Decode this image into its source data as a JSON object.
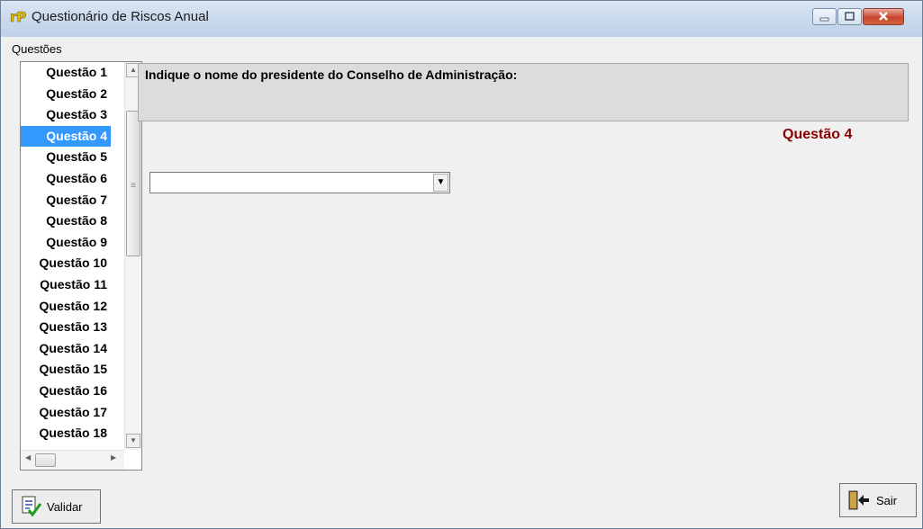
{
  "window": {
    "title": "Questionário de Riscos Anual",
    "icon": "rp-app-icon"
  },
  "sidebar": {
    "label": "Questões",
    "selected_index": 3,
    "items": [
      {
        "label": "Questão 1"
      },
      {
        "label": "Questão 2"
      },
      {
        "label": "Questão 3"
      },
      {
        "label": "Questão 4"
      },
      {
        "label": "Questão 5"
      },
      {
        "label": "Questão 6"
      },
      {
        "label": "Questão 7"
      },
      {
        "label": "Questão 8"
      },
      {
        "label": "Questão 9"
      },
      {
        "label": "Questão 10"
      },
      {
        "label": "Questão 11"
      },
      {
        "label": "Questão 12"
      },
      {
        "label": "Questão 13"
      },
      {
        "label": "Questão 14"
      },
      {
        "label": "Questão 15"
      },
      {
        "label": "Questão 16"
      },
      {
        "label": "Questão 17"
      },
      {
        "label": "Questão 18"
      }
    ]
  },
  "main": {
    "question_text": "Indique o nome do presidente do Conselho de Administração:",
    "question_number": "Questão 4",
    "answer_value": ""
  },
  "buttons": {
    "validar_label": "Validar",
    "sair_label": "Sair"
  },
  "colors": {
    "selection": "#3399ff",
    "question_number": "#8b0000",
    "question_box": "#dcdcdc"
  }
}
